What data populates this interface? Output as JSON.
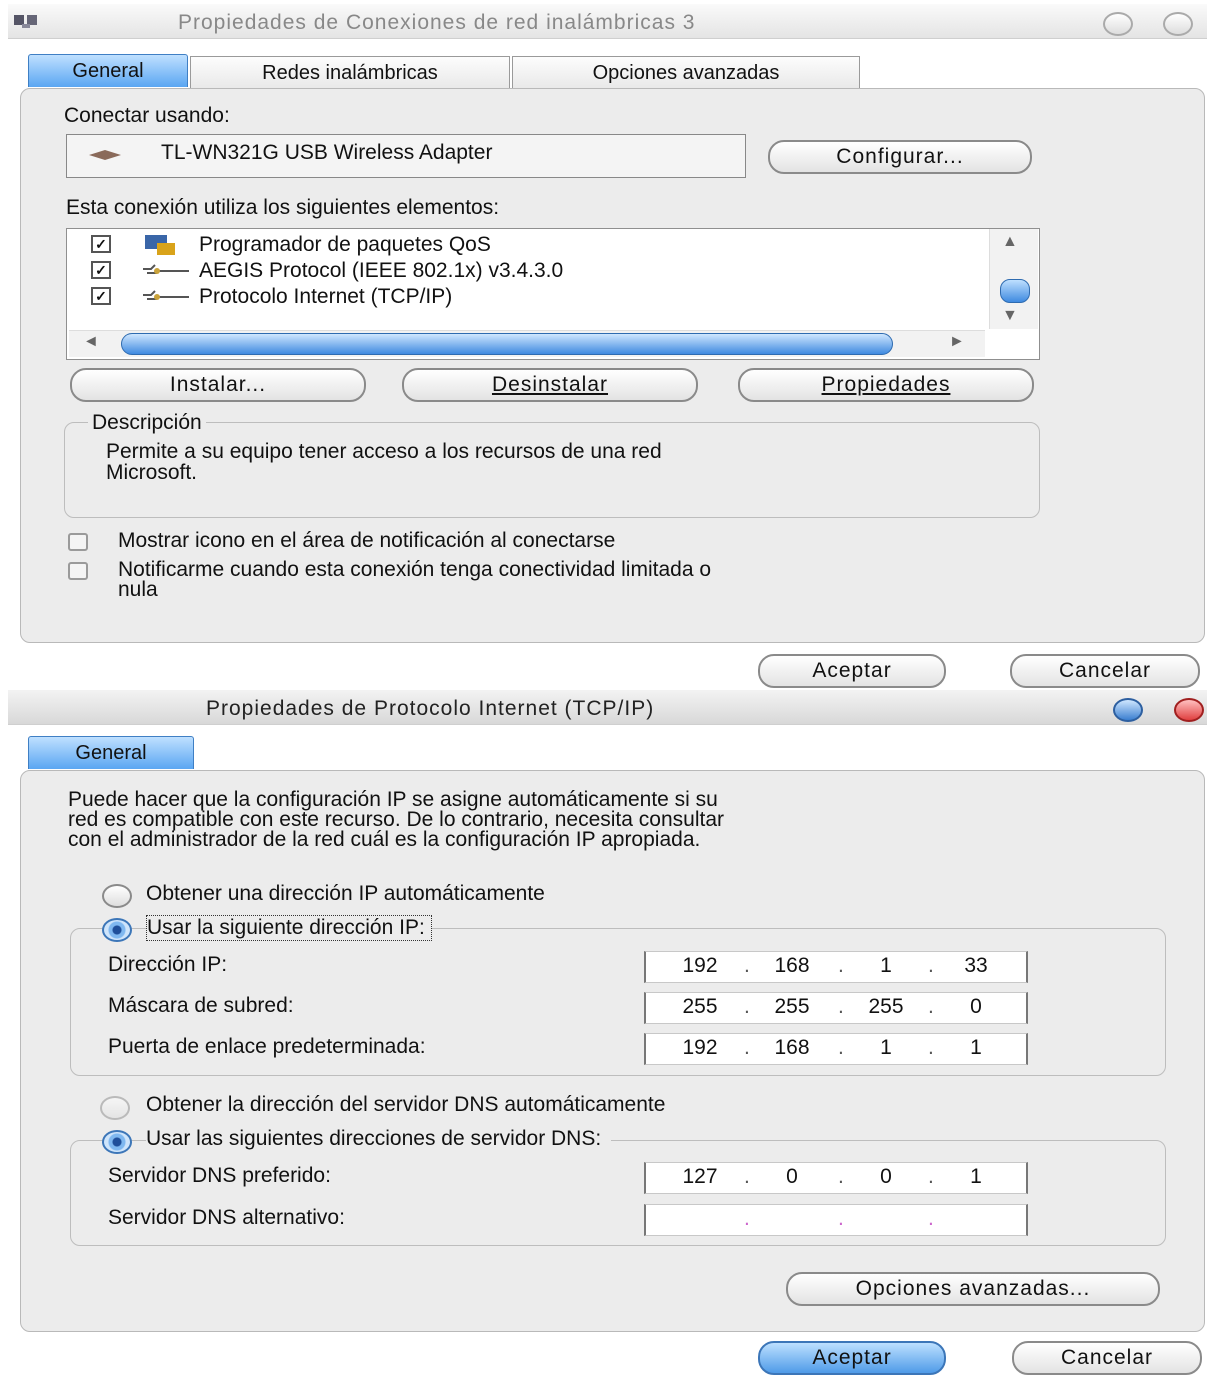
{
  "dialog1": {
    "title": "Propiedades de Conexiones de red inalámbricas 3",
    "tabs": [
      "General",
      "Redes inalámbricas",
      "Opciones avanzadas"
    ],
    "connect_using_label": "Conectar usando:",
    "adapter": "TL-WN321G USB Wireless Adapter",
    "configure_button": "Configurar...",
    "elements_label": "Esta conexión utiliza los siguientes elementos:",
    "components": [
      {
        "label": "Programador de paquetes QoS",
        "checked": true
      },
      {
        "label": "AEGIS Protocol (IEEE 802.1x) v3.4.3.0",
        "checked": true
      },
      {
        "label": "Protocolo Internet (TCP/IP)",
        "checked": true
      }
    ],
    "install_button": "Instalar...",
    "uninstall_button": "Desinstalar",
    "properties_button": "Propiedades",
    "description_label": "Descripción",
    "description_line1": "Permite a su equipo tener acceso a los recursos de una red",
    "description_line2": "Microsoft.",
    "show_icon_label": "Mostrar icono en el área de notificación al conectarse",
    "notify_line1": "Notificarme cuando esta conexión tenga conectividad limitada o",
    "notify_line2": "nula",
    "ok_button": "Aceptar",
    "cancel_button": "Cancelar"
  },
  "dialog2": {
    "title": "Propiedades de Protocolo Internet (TCP/IP)",
    "tab": "General",
    "intro_line1": "Puede hacer que la configuración IP se asigne automáticamente si su",
    "intro_line2": "red es compatible con este recurso. De lo contrario, necesita consultar",
    "intro_line3": "con el administrador de la red cuál es la configuración IP apropiada.",
    "auto_ip_label": "Obtener una dirección IP automáticamente",
    "use_ip_label": "Usar la siguiente dirección IP:",
    "ip_label": "Dirección IP:",
    "ip": [
      "192",
      "168",
      "1",
      "33"
    ],
    "mask_label": "Máscara de subred:",
    "mask": [
      "255",
      "255",
      "255",
      "0"
    ],
    "gateway_label": "Puerta de enlace predeterminada:",
    "gateway": [
      "192",
      "168",
      "1",
      "1"
    ],
    "auto_dns_label": "Obtener la dirección del servidor DNS automáticamente",
    "use_dns_label": "Usar las siguientes direcciones de servidor DNS:",
    "dns_pref_label": "Servidor DNS preferido:",
    "dns_pref": [
      "127",
      "0",
      "0",
      "1"
    ],
    "dns_alt_label": "Servidor DNS alternativo:",
    "advanced_button": "Opciones avanzadas...",
    "ok_button": "Aceptar",
    "cancel_button": "Cancelar"
  },
  "colors": {
    "accent_blue": "#5aa6f2",
    "close_red": "#e04040"
  }
}
